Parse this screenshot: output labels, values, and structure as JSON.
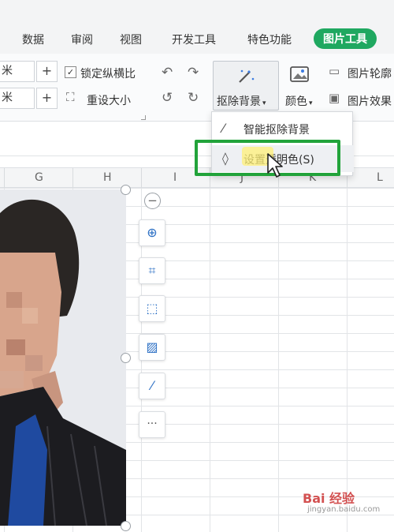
{
  "ribbon": {
    "tabs": [
      {
        "label": "数据"
      },
      {
        "label": "审阅"
      },
      {
        "label": "视图"
      },
      {
        "label": "开发工具"
      },
      {
        "label": "特色功能"
      },
      {
        "label": "图片工具"
      }
    ],
    "active_tab_color": "#1fa860"
  },
  "size_group": {
    "height_unit": "米",
    "width_unit": "米",
    "plus": "+",
    "lock_ratio_label": "锁定纵横比",
    "lock_ratio_checked": true,
    "lock_ratio_check": "✓",
    "reset_size_label": "重设大小"
  },
  "tools": {
    "remove_bg_label": "抠除背景",
    "color_label": "颜色",
    "outline_label": "图片轮廓",
    "effect_label": "图片效果",
    "caret": "▾"
  },
  "columns": [
    "G",
    "H",
    "I",
    "J",
    "K",
    "L"
  ],
  "dropdown": {
    "items": [
      {
        "label": "智能抠除背景"
      },
      {
        "label": "设置透明色(S)"
      }
    ],
    "highlight_color": "#22a33a"
  },
  "float_toolbar": {
    "collapse": "−",
    "more": "···"
  },
  "watermark": {
    "text": "Bai 经验",
    "sub": "jingyan.baidu.com"
  }
}
